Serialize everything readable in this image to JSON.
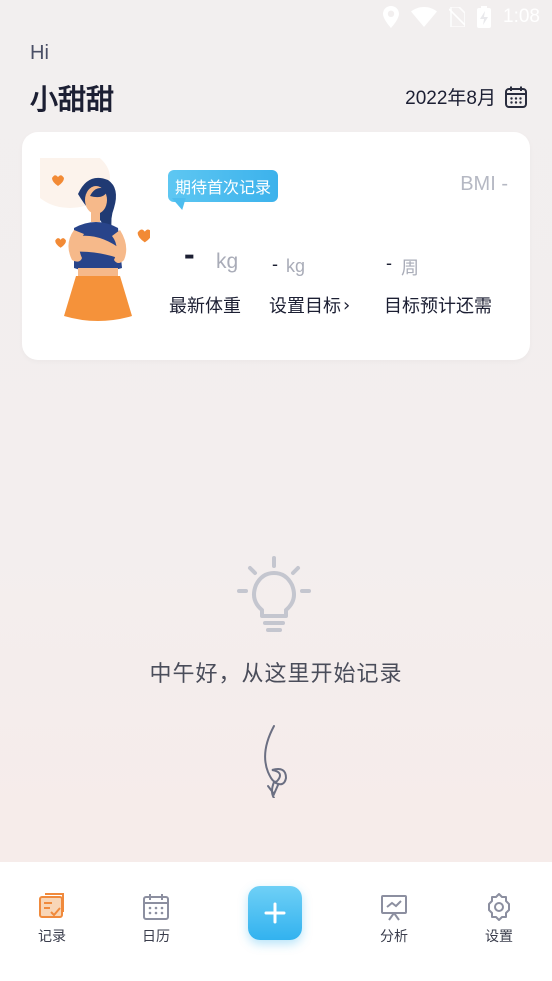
{
  "status_bar": {
    "time": "1:08",
    "icons": [
      "location-icon",
      "wifi-icon",
      "no-sim-icon",
      "battery-charging-icon"
    ]
  },
  "header": {
    "greeting": "Hi",
    "username": "小甜甜",
    "month": "2022年8月",
    "month_icon": "calendar-icon"
  },
  "card": {
    "bubble_text": "期待首次记录",
    "bmi": "BMI -",
    "latest_weight": {
      "value": "-",
      "unit": "kg",
      "label": "最新体重"
    },
    "goal": {
      "value": "-",
      "unit": "kg",
      "label": "设置目标",
      "chevron": "›"
    },
    "weeks": {
      "value": "-",
      "unit": "周",
      "label": "目标预计还需"
    }
  },
  "empty_state": {
    "icon": "lightbulb-icon",
    "message": "中午好，从这里开始记录"
  },
  "tabbar": {
    "items": [
      {
        "label": "记录",
        "icon": "record-icon",
        "active": true
      },
      {
        "label": "日历",
        "icon": "calendar-icon"
      },
      {
        "label": "分析",
        "icon": "analysis-icon"
      },
      {
        "label": "设置",
        "icon": "settings-gear-icon"
      }
    ],
    "add_icon": "plus-icon"
  },
  "colors": {
    "accent": "#3cb2ec",
    "active_tab": "#f08a3c",
    "text": "#1c1f33",
    "muted": "#a9acb8"
  }
}
